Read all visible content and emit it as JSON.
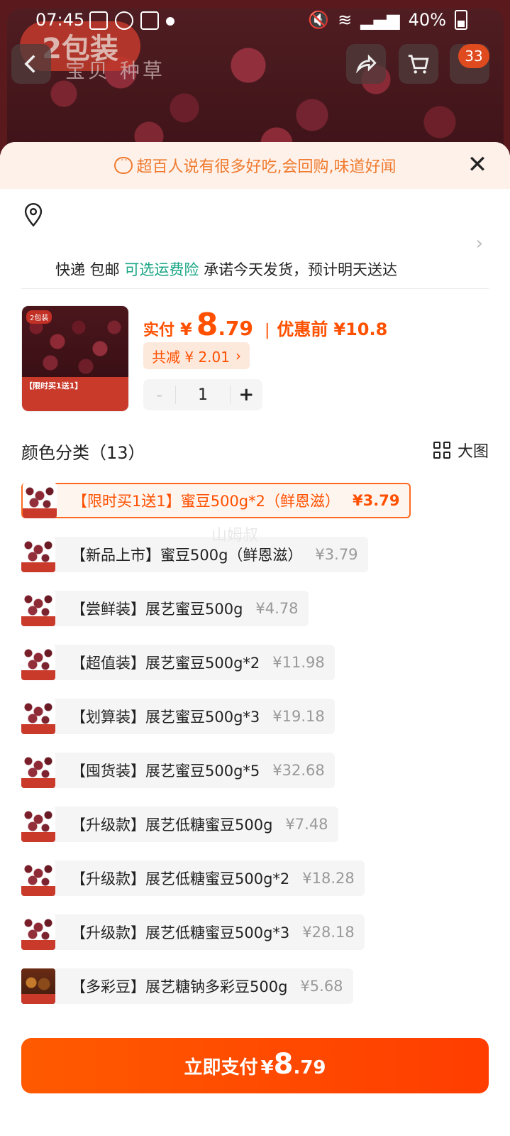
{
  "status_bar": {
    "time": "07:45",
    "battery": "40%"
  },
  "header": {
    "badge": "2包装",
    "tabs": "宝贝  种草",
    "cart_count": "33"
  },
  "sheet": {
    "banner": "超百人说有很多好吃,会回购,味道好闻",
    "address": "",
    "shipping": {
      "express": "快递 包邮",
      "insurance": "可选运费险",
      "promise": "承诺今天发货，预计明天送达"
    },
    "product": {
      "image_tag": "2包装",
      "image_strip": "【限时买1送1】",
      "price_label": "实付",
      "currency": "¥",
      "price_int": "8",
      "price_dec": ".79",
      "before_label": "优惠前",
      "before_price": "¥10.8",
      "discount": "共减 ¥ 2.01",
      "discount_chevron": "›",
      "quantity": "1",
      "minus": "-",
      "plus": "+"
    },
    "section_title": "颜色分类（13）",
    "big_view": "大图",
    "watermark": "山姆叔",
    "options": [
      {
        "name": "【限时买1送1】蜜豆500g*2（鲜恩滋）",
        "price": "¥3.79",
        "selected": true
      },
      {
        "name": "【新品上市】蜜豆500g（鲜恩滋）",
        "price": "¥3.79"
      },
      {
        "name": "【尝鲜装】展艺蜜豆500g",
        "price": "¥4.78"
      },
      {
        "name": "【超值装】展艺蜜豆500g*2",
        "price": "¥11.98"
      },
      {
        "name": "【划算装】展艺蜜豆500g*3",
        "price": "¥19.18"
      },
      {
        "name": "【囤货装】展艺蜜豆500g*5",
        "price": "¥32.68"
      },
      {
        "name": "【升级款】展艺低糖蜜豆500g",
        "price": "¥7.48"
      },
      {
        "name": "【升级款】展艺低糖蜜豆500g*2",
        "price": "¥18.28"
      },
      {
        "name": "【升级款】展艺低糖蜜豆500g*3",
        "price": "¥28.18"
      },
      {
        "name": "【多彩豆】展艺糖钠多彩豆500g",
        "price": "¥5.68"
      }
    ],
    "pay": {
      "label": "立即支付",
      "currency": "¥",
      "price_int": "8",
      "price_dec": ".79"
    }
  },
  "colors": {
    "accent": "#ff5000",
    "green": "#1aa585",
    "banner_bg": "#fdf1ea"
  }
}
